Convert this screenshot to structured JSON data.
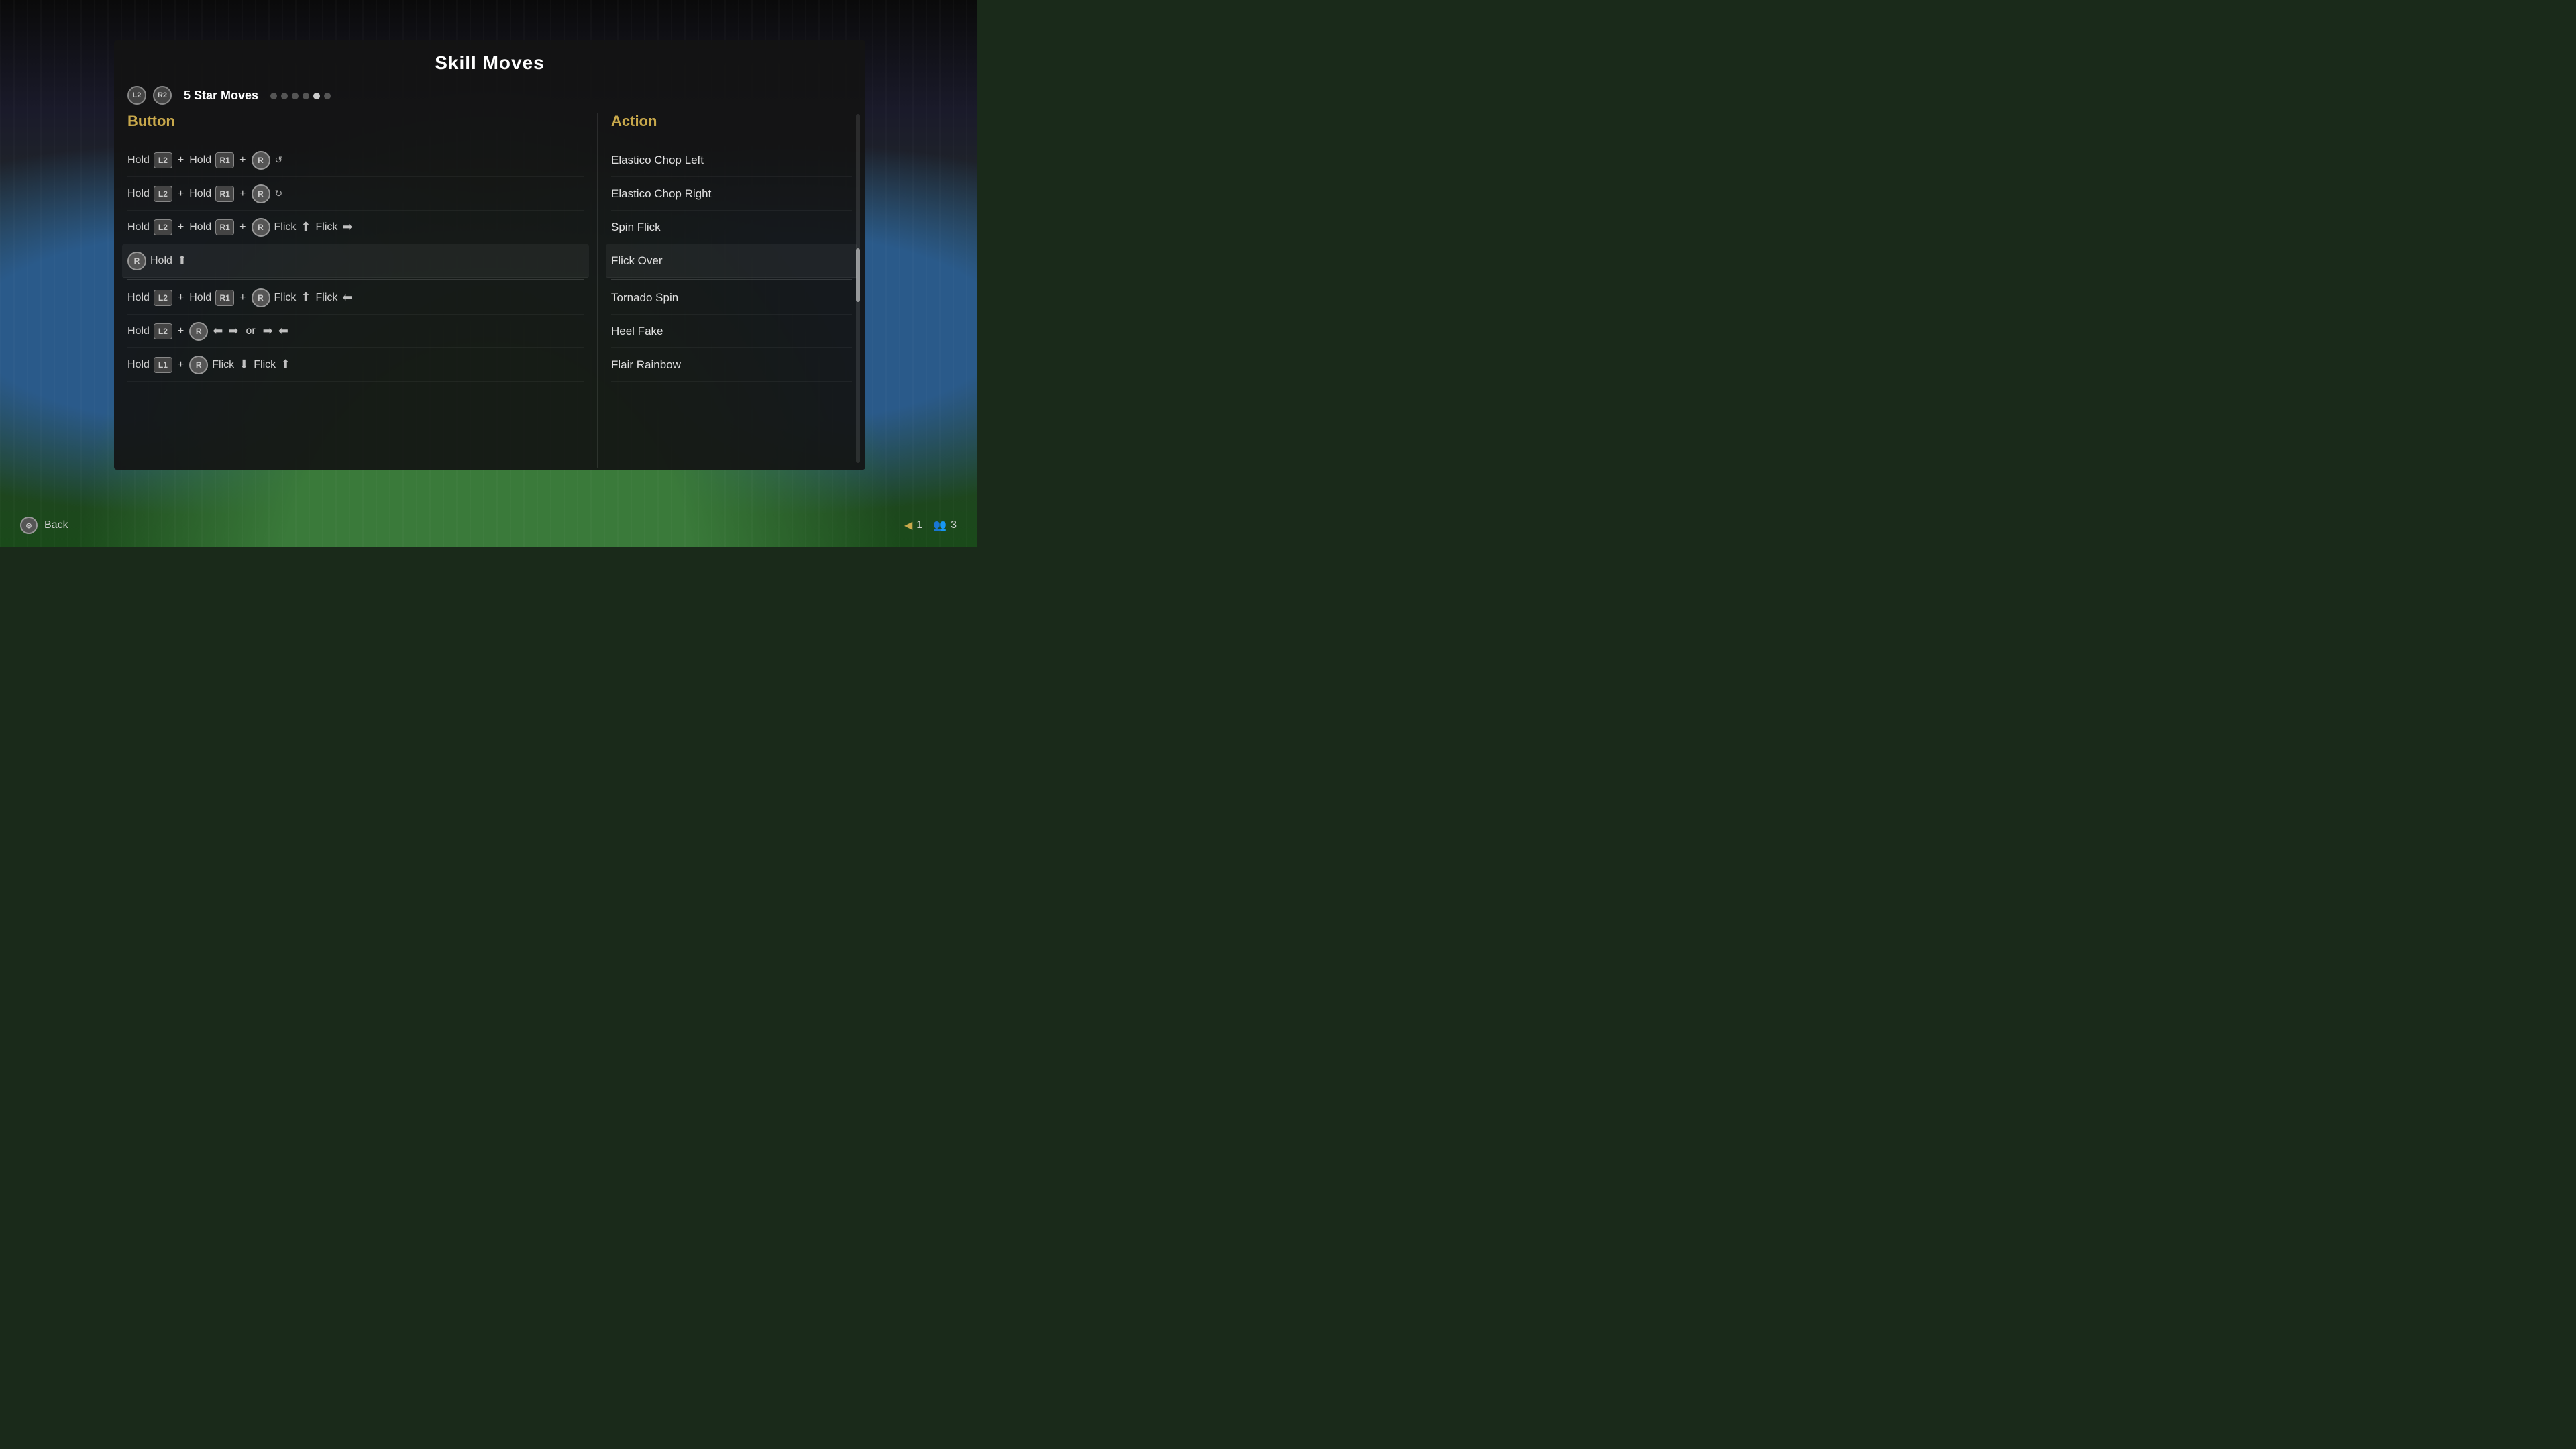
{
  "page": {
    "title": "Skill Moves",
    "background_color": "#141414"
  },
  "nav": {
    "button1": "L2",
    "button2": "R2",
    "section_title": "5 Star Moves",
    "dots": [
      {
        "active": false
      },
      {
        "active": false
      },
      {
        "active": false
      },
      {
        "active": false
      },
      {
        "active": true
      },
      {
        "active": false
      }
    ]
  },
  "columns": {
    "button_header": "Button",
    "action_header": "Action"
  },
  "moves": [
    {
      "id": 1,
      "buttons": "Hold L2 + Hold R1 + R rotate-left",
      "action": "Elastico Chop Left",
      "highlighted": false
    },
    {
      "id": 2,
      "buttons": "Hold L2 + Hold R1 + R rotate-right",
      "action": "Elastico Chop Right",
      "highlighted": false
    },
    {
      "id": 3,
      "buttons": "Hold L2 + Hold R1 + R Flick up Flick right",
      "action": "Spin Flick",
      "highlighted": false
    },
    {
      "id": 4,
      "buttons": "R Hold up",
      "action": "Flick Over",
      "highlighted": true
    },
    {
      "id": 5,
      "buttons": "Hold L2 + Hold R1 + R Flick up Flick left",
      "action": "Tornado Spin",
      "highlighted": false
    },
    {
      "id": 6,
      "buttons": "Hold L2 + R left right or right left",
      "action": "Heel Fake",
      "highlighted": false
    },
    {
      "id": 7,
      "buttons": "Hold L1 + R Flick down Flick up",
      "action": "Flair Rainbow",
      "highlighted": false
    }
  ],
  "bottom": {
    "back_label": "Back",
    "page_number": "1",
    "total_players": "3"
  }
}
